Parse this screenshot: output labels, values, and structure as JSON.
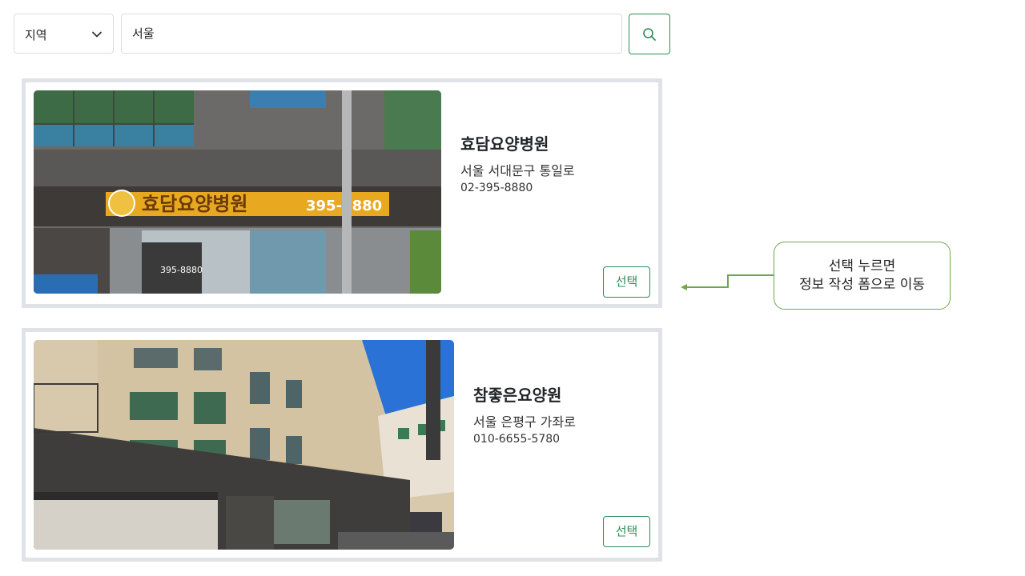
{
  "search": {
    "region_label": "지역",
    "query": "서울",
    "icon": "search-icon"
  },
  "facilities": [
    {
      "name": "효담요양병원",
      "address": "서울 서대문구 통일로",
      "phone": "02-395-8880",
      "select_label": "선택",
      "photo_sign_text": "효담요양병원",
      "photo_sign_phone": "395-8880"
    },
    {
      "name": "참좋은요양원",
      "address": "서울 은평구 가좌로",
      "phone": "010-6655-5780",
      "select_label": "선택"
    }
  ],
  "annotation": {
    "line1": "선택 누르면",
    "line2": "정보 작성 폼으로 이동"
  },
  "colors": {
    "accent": "#2e8b57",
    "card_border": "#dfe2e6",
    "callout_border": "#70a84b"
  }
}
